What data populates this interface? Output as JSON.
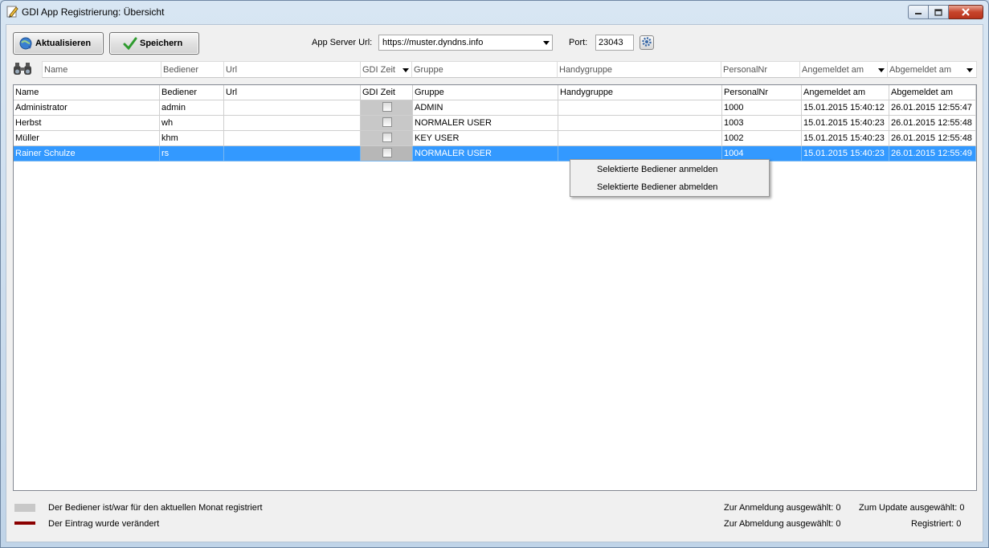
{
  "window": {
    "title": "GDI App Registrierung: Übersicht"
  },
  "toolbar": {
    "refresh_label": "Aktualisieren",
    "save_label": "Speichern",
    "server_url_label": "App Server Url:",
    "server_url_value": "https://muster.dyndns.info",
    "port_label": "Port:",
    "port_value": "23043"
  },
  "filters": [
    {
      "placeholder": "Name"
    },
    {
      "placeholder": "Bediener"
    },
    {
      "placeholder": "Url"
    },
    {
      "placeholder": "GDI Zeit",
      "dropdown": true
    },
    {
      "placeholder": "Gruppe"
    },
    {
      "placeholder": "Handygruppe"
    },
    {
      "placeholder": "PersonalNr"
    },
    {
      "placeholder": "Angemeldet am",
      "dropdown": true
    },
    {
      "placeholder": "Abgemeldet am",
      "dropdown": true
    }
  ],
  "table": {
    "columns": [
      "Name",
      "Bediener",
      "Url",
      "GDI Zeit",
      "Gruppe",
      "Handygruppe",
      "PersonalNr",
      "Angemeldet am",
      "Abgemeldet am"
    ],
    "rows": [
      {
        "name": "Administrator",
        "bediener": "admin",
        "url": "",
        "gdi_zeit": false,
        "gruppe": "ADMIN",
        "handygruppe": "",
        "personalnr": "1000",
        "angemeldet": "15.01.2015 15:40:12",
        "abgemeldet": "26.01.2015 12:55:47",
        "selected": false
      },
      {
        "name": "Herbst",
        "bediener": "wh",
        "url": "",
        "gdi_zeit": false,
        "gruppe": "NORMALER USER",
        "handygruppe": "",
        "personalnr": "1003",
        "angemeldet": "15.01.2015 15:40:23",
        "abgemeldet": "26.01.2015 12:55:48",
        "selected": false
      },
      {
        "name": "Müller",
        "bediener": "khm",
        "url": "",
        "gdi_zeit": false,
        "gruppe": "KEY USER",
        "handygruppe": "",
        "personalnr": "1002",
        "angemeldet": "15.01.2015 15:40:23",
        "abgemeldet": "26.01.2015 12:55:48",
        "selected": false
      },
      {
        "name": "Rainer Schulze",
        "bediener": "rs",
        "url": "",
        "gdi_zeit": false,
        "gruppe": "NORMALER USER",
        "handygruppe": "",
        "personalnr": "1004",
        "angemeldet": "15.01.2015 15:40:23",
        "abgemeldet": "26.01.2015 12:55:49",
        "selected": true
      }
    ]
  },
  "context_menu": {
    "items": [
      "Selektierte Bediener anmelden",
      "Selektierte Bediener abmelden"
    ]
  },
  "legend": {
    "registered_text": "Der Bediener ist/war für den aktuellen Monat registriert",
    "registered_color": "#c8c8c8",
    "changed_text": "Der Eintrag wurde verändert",
    "changed_color": "#8b0000"
  },
  "status": {
    "login_selected": "Zur Anmeldung ausgewählt: 0",
    "update_selected": "Zum Update ausgewählt: 0",
    "logout_selected": "Zur Abmeldung ausgewählt: 0",
    "registered": "Registriert: 0"
  },
  "colors": {
    "selection": "#3399ff",
    "title_gradient_top": "#d8e6f3",
    "close_button": "#c7452c"
  }
}
